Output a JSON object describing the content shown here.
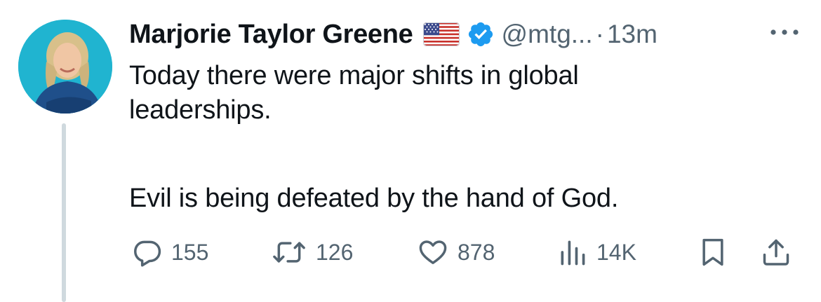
{
  "author": {
    "name": "Marjorie Taylor Greene",
    "flag_emoji": "us-flag-icon",
    "verified_badge": "verified-badge-icon",
    "handle": "@mtg...",
    "separator": "·",
    "time": "13m"
  },
  "tweet": {
    "line1": "Today there were major shifts in global",
    "line2": "leaderships.",
    "line3": "Evil is being defeated by the hand of God."
  },
  "actions": {
    "replies": "155",
    "retweets": "126",
    "likes": "878",
    "views": "14K"
  },
  "colors": {
    "text": "#0f1419",
    "secondary": "#536471",
    "verified": "#1d9bf0",
    "thread_line": "#cfd9de"
  }
}
